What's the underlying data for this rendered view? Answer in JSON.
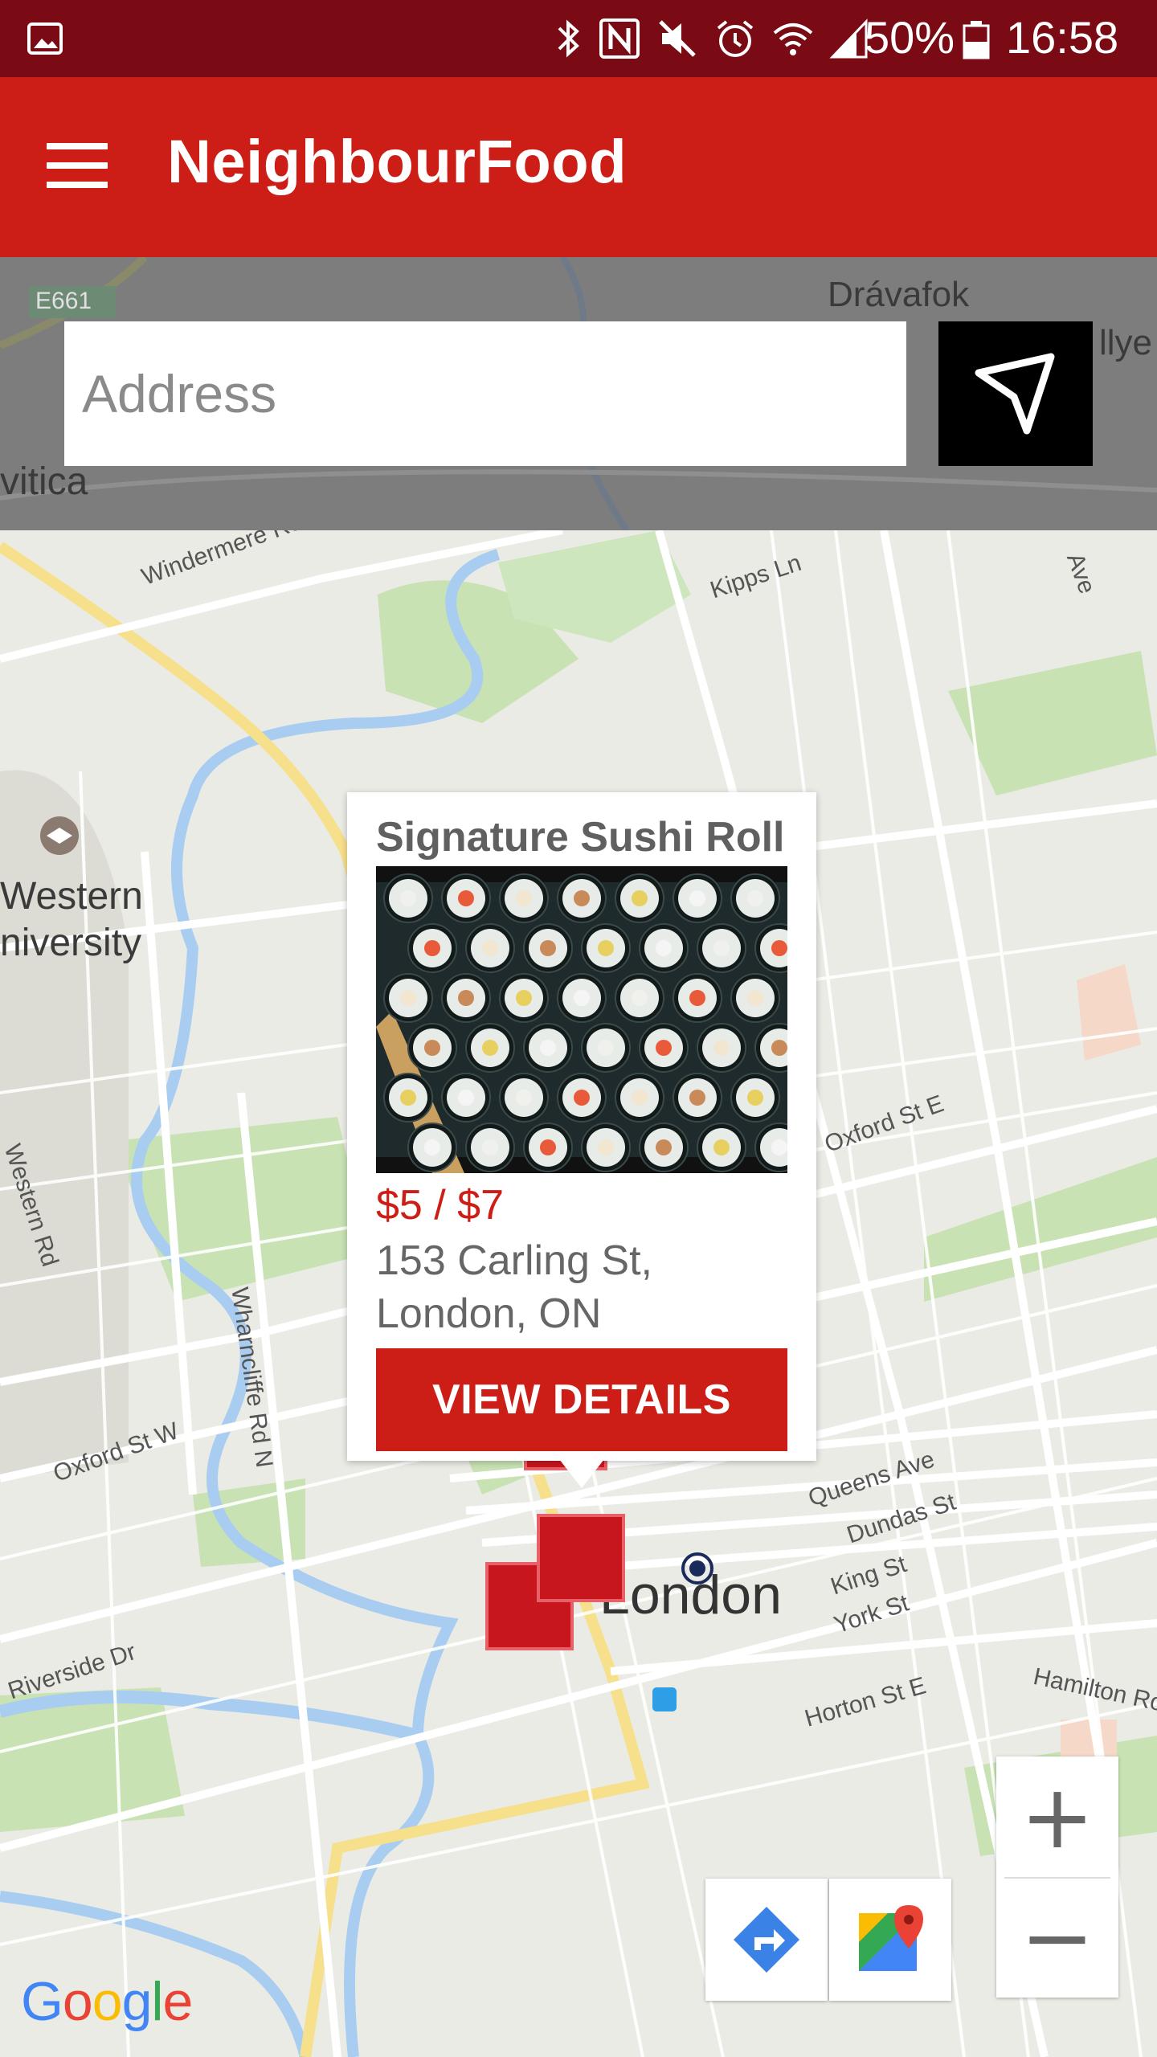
{
  "status_bar": {
    "battery": "50%",
    "time": "16:58"
  },
  "app_bar": {
    "title": "NeighbourFood",
    "menu_icon": "hamburger-menu-icon"
  },
  "search": {
    "placeholder": "Address",
    "value": "",
    "locate_icon": "navigation-arrow-icon",
    "background_labels": [
      "E661",
      "Drávafok",
      "vitica",
      "llye"
    ]
  },
  "map": {
    "street_labels": [
      "Windermere Rd",
      "Kipps Ln",
      "Ave",
      "Western",
      "niversity",
      "Oxford St E",
      "Western Rd",
      "Wharncliffe Rd N",
      "Oxford St W",
      "Queens Ave",
      "Dundas St",
      "King St",
      "York St",
      "London",
      "Riverside Dr",
      "Horton St E",
      "Hamilton Ro"
    ],
    "zoom_in": "+",
    "zoom_out": "−",
    "google_logo": "Google"
  },
  "popup": {
    "title": "Signature Sushi Roll",
    "image_icon": "sushi-photo",
    "price": "$5 / $7",
    "address_line1": "153 Carling St,",
    "address_line2": "London, ON",
    "button_label": "VIEW DETAILS"
  },
  "colors": {
    "primary": "#cc1e16",
    "status_bar": "#7a0a14",
    "marker": "#c8161f"
  }
}
